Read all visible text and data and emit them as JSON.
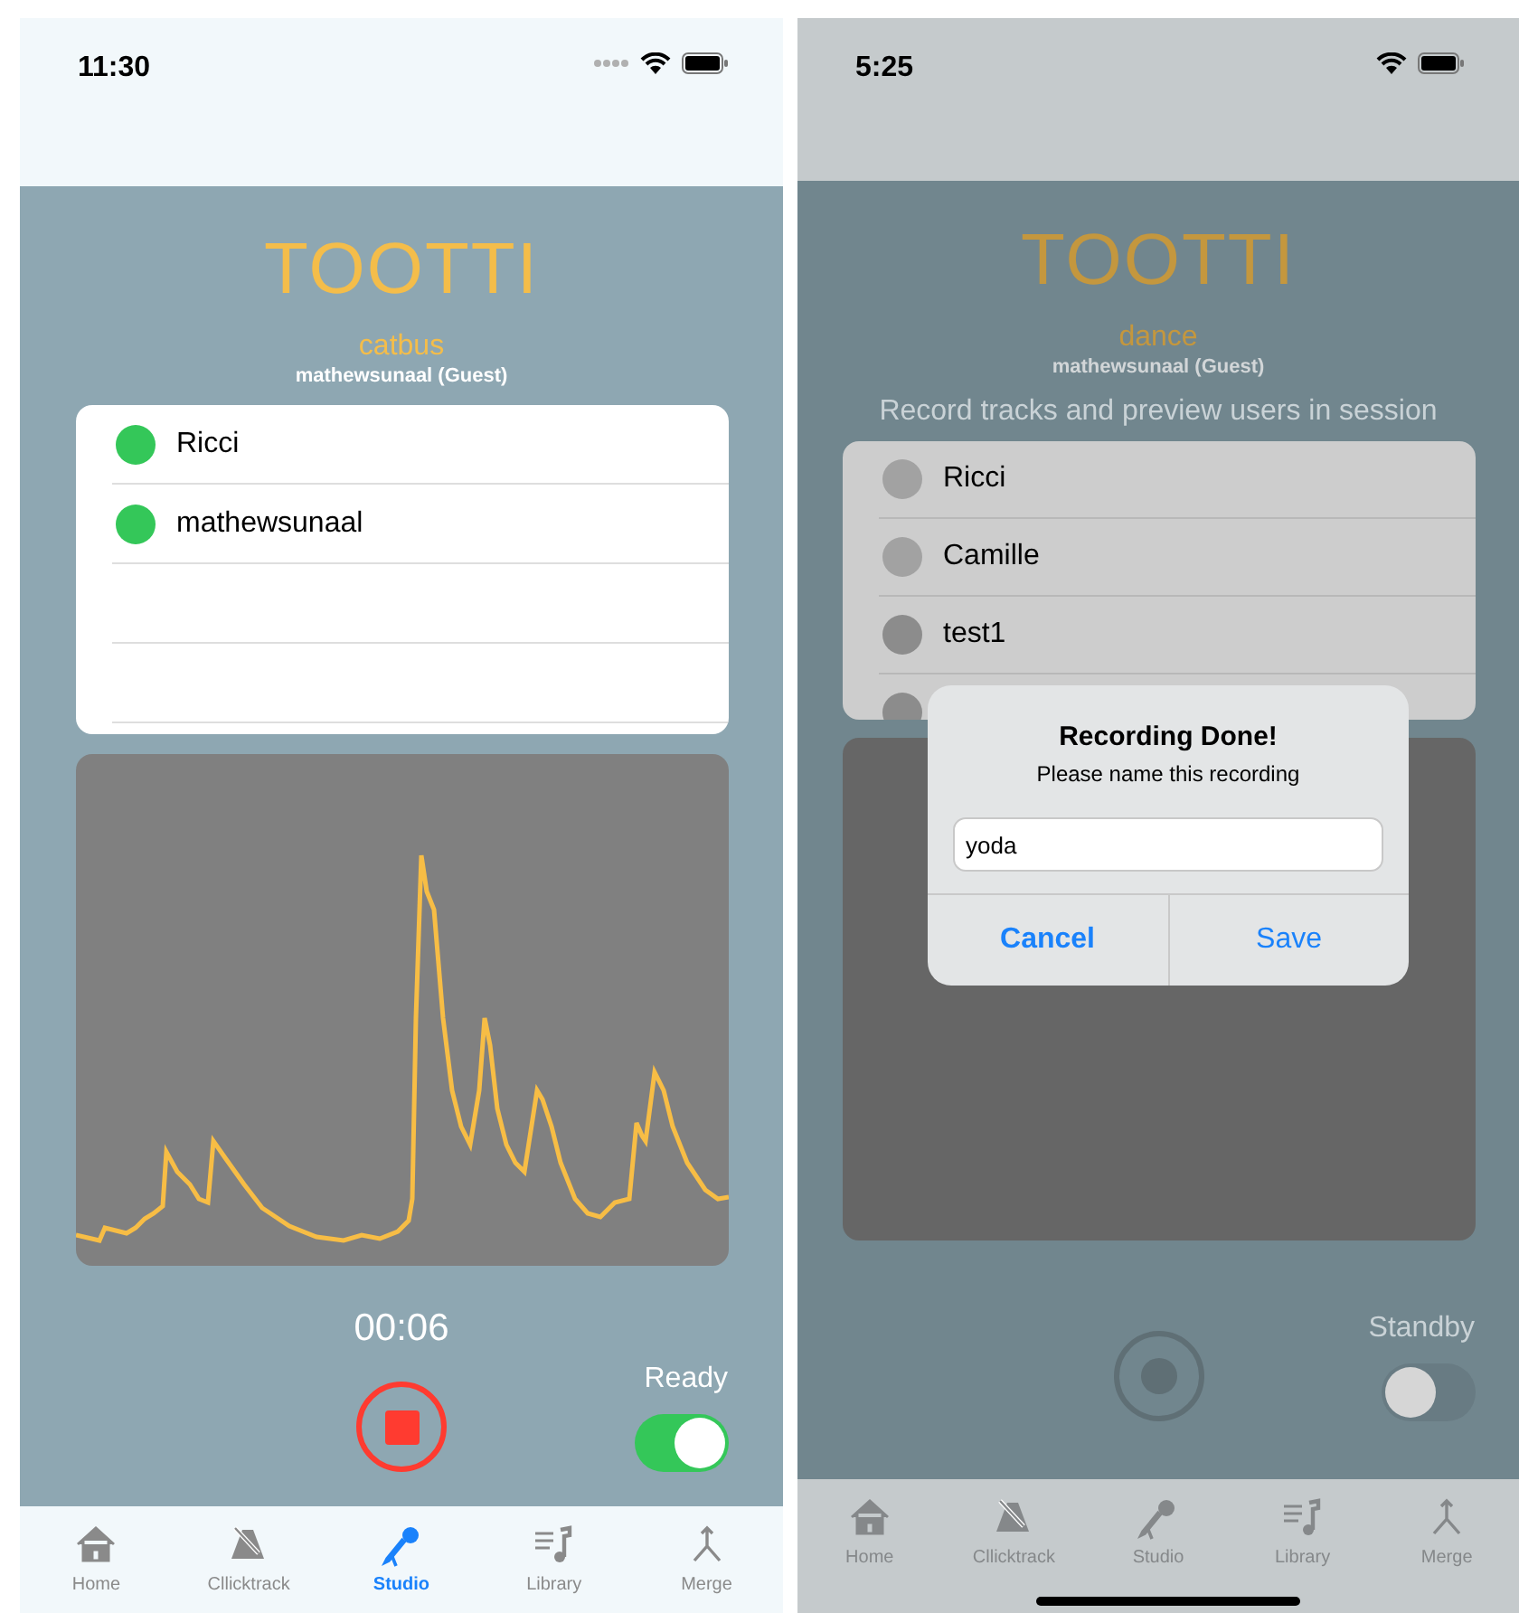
{
  "screens": [
    {
      "dimmed": false,
      "status_bar": {
        "time": "11:30"
      },
      "logo": "TOOTTI",
      "session": "catbus",
      "user_line": "mathewsunaal (Guest)",
      "users": [
        {
          "kind": "user",
          "name": "Ricci",
          "color": "#34c759"
        },
        {
          "kind": "user",
          "name": "mathewsunaal",
          "color": "#34c759"
        },
        {
          "kind": "empty"
        },
        {
          "kind": "empty"
        }
      ],
      "timer": "00:06",
      "record_button": {
        "kind": "stop"
      },
      "toggle": {
        "label": "Ready",
        "on": true
      },
      "tabs": [
        {
          "label": "Home",
          "selected": false
        },
        {
          "label": "Cllicktrack",
          "selected": false
        },
        {
          "label": "Studio",
          "selected": true
        },
        {
          "label": "Library",
          "selected": false
        },
        {
          "label": "Merge",
          "selected": false
        }
      ]
    },
    {
      "dimmed": true,
      "status_bar": {
        "time": "5:25"
      },
      "logo": "TOOTTI",
      "session": "dance",
      "user_line": "mathewsunaal (Guest)",
      "subtitle": "Record tracks and preview users in session",
      "users": [
        {
          "kind": "user",
          "name": "Ricci",
          "color": "#a2a2a2"
        },
        {
          "kind": "user",
          "name": "Camille",
          "color": "#a2a2a2"
        },
        {
          "kind": "user",
          "name": "test1",
          "color": "#8c8c8c"
        },
        {
          "kind": "user",
          "color": "#8c8c8c"
        }
      ],
      "record_button": {
        "kind": "record"
      },
      "toggle": {
        "label": "Standby",
        "on": false
      },
      "dialog": {
        "title": "Recording Done!",
        "message": "Please name this recording",
        "value": "yoda",
        "buttons": [
          "Cancel",
          "Save"
        ]
      },
      "tabs": [
        {
          "label": "Home",
          "selected": false
        },
        {
          "label": "Cllicktrack",
          "selected": false
        },
        {
          "label": "Studio",
          "selected": false
        },
        {
          "label": "Library",
          "selected": false
        },
        {
          "label": "Merge",
          "selected": false
        }
      ]
    }
  ]
}
